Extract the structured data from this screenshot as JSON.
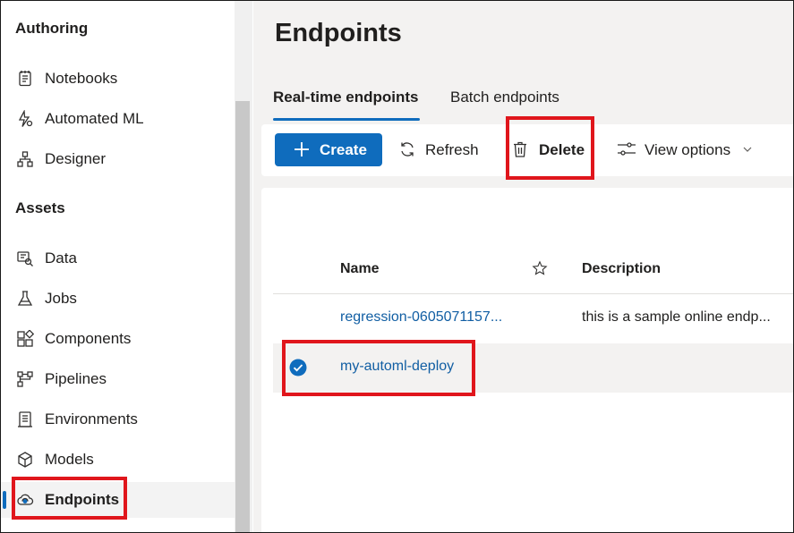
{
  "sidebar": {
    "authoring_title": "Authoring",
    "authoring_items": [
      {
        "label": "Notebooks",
        "icon": "notebook-icon"
      },
      {
        "label": "Automated ML",
        "icon": "automated-ml-icon"
      },
      {
        "label": "Designer",
        "icon": "designer-icon"
      }
    ],
    "assets_title": "Assets",
    "assets_items": [
      {
        "label": "Data",
        "icon": "data-icon"
      },
      {
        "label": "Jobs",
        "icon": "flask-icon"
      },
      {
        "label": "Components",
        "icon": "components-icon"
      },
      {
        "label": "Pipelines",
        "icon": "pipelines-icon"
      },
      {
        "label": "Environments",
        "icon": "environments-icon"
      },
      {
        "label": "Models",
        "icon": "cube-icon"
      },
      {
        "label": "Endpoints",
        "icon": "endpoints-cloud-icon",
        "selected": true
      }
    ]
  },
  "main": {
    "title": "Endpoints",
    "tabs": [
      {
        "label": "Real-time endpoints",
        "active": true
      },
      {
        "label": "Batch endpoints",
        "active": false
      }
    ],
    "toolbar": {
      "create_label": "Create",
      "refresh_label": "Refresh",
      "delete_label": "Delete",
      "view_options_label": "View options"
    },
    "table": {
      "columns": [
        "Name",
        "Description"
      ],
      "favorite_icon": "star-icon",
      "rows": [
        {
          "name": "regression-0605071157...",
          "description": "this is a sample online endp...",
          "selected": false
        },
        {
          "name": "my-automl-deploy",
          "description": "",
          "selected": true
        }
      ]
    }
  },
  "colors": {
    "accent": "#0f6cbd",
    "link": "#115ea3",
    "highlight": "#e0161c"
  }
}
